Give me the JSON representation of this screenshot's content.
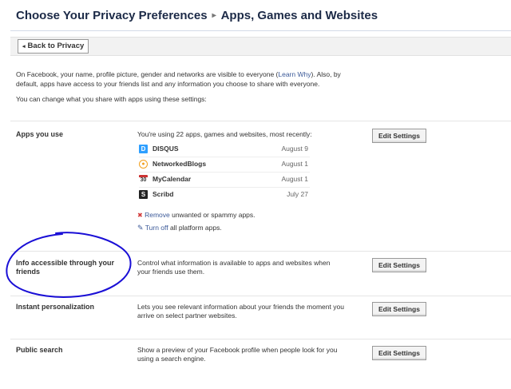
{
  "header": {
    "crumb": "Choose Your Privacy Preferences",
    "separator": "▸",
    "current": "Apps, Games and Websites"
  },
  "toolbar": {
    "back_arrow": "◂",
    "back_label": "Back to Privacy"
  },
  "intro": {
    "text_1": "On Facebook, your name, profile picture, gender and networks are visible to everyone (",
    "learn_why": "Learn Why",
    "text_2": "). Also, by default, apps have access to your friends list and any information you choose to share with everyone.",
    "line_2": "You can change what you share with apps using these settings:"
  },
  "sections": [
    {
      "label": "Apps you use",
      "description": "You're using 22 apps, games and websites, most recently:",
      "button": "Edit Settings"
    },
    {
      "label": "Info accessible through your friends",
      "description": "Control what information is available to apps and websites when your friends use them.",
      "button": "Edit Settings"
    },
    {
      "label": "Instant personalization",
      "description": "Lets you see relevant information about your friends the moment you arrive on select partner websites.",
      "button": "Edit Settings"
    },
    {
      "label": "Public search",
      "description": "Show a preview of your Facebook profile when people look for you using a search engine.",
      "button": "Edit Settings"
    }
  ],
  "apps": [
    {
      "icon": "disqus-icon",
      "icon_glyph": "D",
      "color": "#2e9fff",
      "name": "DISQUS",
      "date": "August 9"
    },
    {
      "icon": "networkedblogs-icon",
      "icon_glyph": "●",
      "color": "#f2a01f",
      "name": "NetworkedBlogs",
      "date": "August 1"
    },
    {
      "icon": "mycalendar-icon",
      "icon_glyph": "30",
      "color": "#cc3333",
      "name": "MyCalendar",
      "date": "August 1"
    },
    {
      "icon": "scribd-icon",
      "icon_glyph": "S",
      "color": "#222222",
      "name": "Scribd",
      "date": "July 27"
    }
  ],
  "links": {
    "remove_icon": "✖",
    "remove_link": "Remove",
    "remove_rest": " unwanted or spammy apps.",
    "turnoff_icon": "✎",
    "turnoff_link": "Turn off",
    "turnoff_rest": " all platform apps."
  },
  "colors": {
    "link": "#3b5998",
    "title": "#1c2a47",
    "annotation": "#1a0fd6",
    "remove": "#d23a3a"
  }
}
